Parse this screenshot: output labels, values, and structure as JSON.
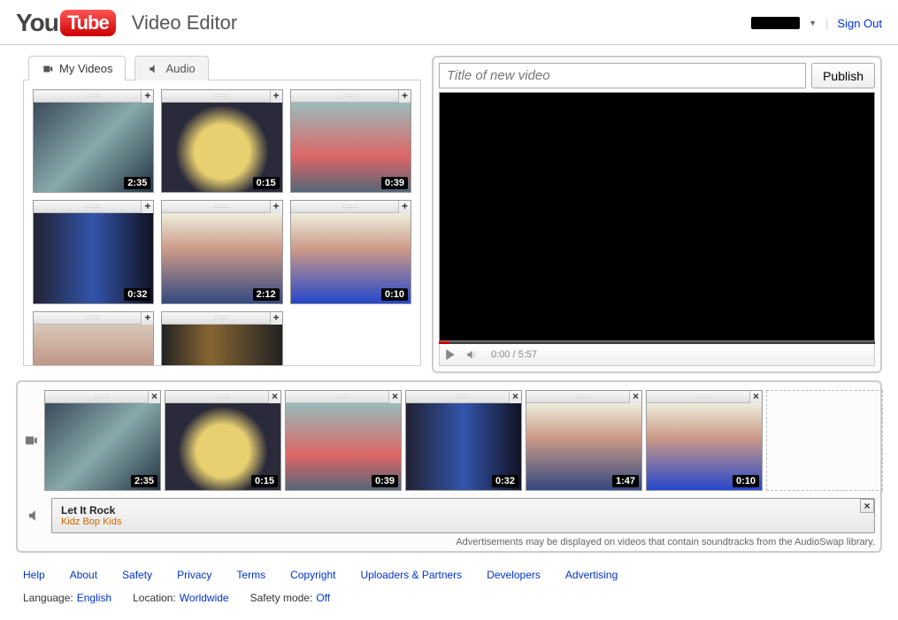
{
  "header": {
    "logo_you": "You",
    "logo_tube": "Tube",
    "page_title": "Video Editor",
    "signout": "Sign Out"
  },
  "tabs": {
    "videos": "My Videos",
    "audio": "Audio"
  },
  "library": [
    {
      "duration": "2:35",
      "bg": "linear-gradient(135deg,#3a4a5a,#8aa,#234)"
    },
    {
      "duration": "0:15",
      "bg": "radial-gradient(circle at 50% 55%,#e8d070 35%,#2a2a3a 60%)"
    },
    {
      "duration": "0:39",
      "bg": "linear-gradient(#9bb,#d66 60%,#567)"
    },
    {
      "duration": "0:32",
      "bg": "linear-gradient(90deg,#223,#35a 50%,#112)"
    },
    {
      "duration": "2:12",
      "bg": "linear-gradient(#eed,#c98 40%,#334980)"
    },
    {
      "duration": "0:10",
      "bg": "linear-gradient(#eed,#c98 40%,#2447cc)"
    },
    {
      "duration": "",
      "bg": "linear-gradient(#d9c8b8,#b8877a 60%,#a77)"
    },
    {
      "duration": "",
      "bg": "linear-gradient(90deg,#222,#886633 40%,#222)"
    }
  ],
  "editor": {
    "title_placeholder": "Title of new video",
    "publish": "Publish",
    "time": "0:00 / 5:57"
  },
  "timeline": [
    {
      "duration": "2:35",
      "bg": "linear-gradient(135deg,#3a4a5a,#8aa,#234)"
    },
    {
      "duration": "0:15",
      "bg": "radial-gradient(circle at 50% 55%,#e8d070 35%,#2a2a3a 60%)"
    },
    {
      "duration": "0:39",
      "bg": "linear-gradient(#9bb,#d66 60%,#567)"
    },
    {
      "duration": "0:32",
      "bg": "linear-gradient(90deg,#223,#35a 50%,#112)"
    },
    {
      "duration": "1:47",
      "bg": "linear-gradient(#eed,#c98 40%,#334980)"
    },
    {
      "duration": "0:10",
      "bg": "linear-gradient(#eed,#c98 40%,#2447cc)"
    }
  ],
  "audio_clip": {
    "title": "Let It Rock",
    "artist": "Kidz Bop Kids"
  },
  "disclaimer": "Advertisements may be displayed on videos that contain soundtracks from the AudioSwap library.",
  "footer": {
    "links": [
      "Help",
      "About",
      "Safety",
      "Privacy",
      "Terms",
      "Copyright",
      "Uploaders & Partners",
      "Developers",
      "Advertising"
    ],
    "language_lbl": "Language:",
    "language": "English",
    "location_lbl": "Location:",
    "location": "Worldwide",
    "safety_lbl": "Safety mode:",
    "safety": "Off"
  }
}
